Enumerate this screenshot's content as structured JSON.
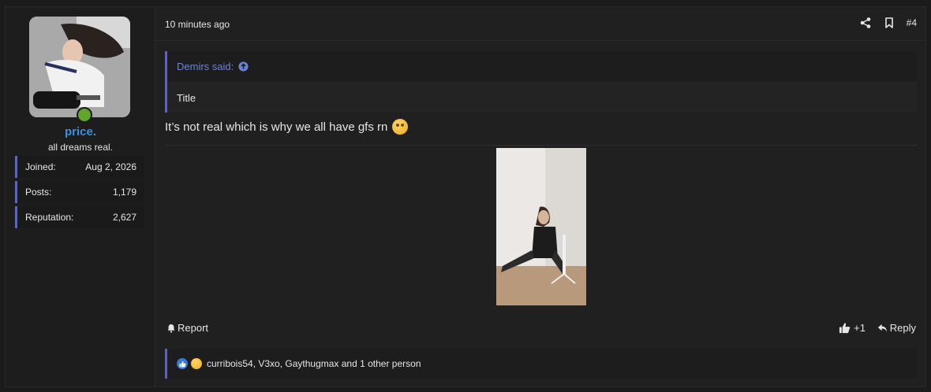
{
  "user": {
    "username": "price.",
    "user_title": "all dreams real.",
    "online": true,
    "stats": [
      {
        "label": "Joined:",
        "value": "Aug 2, 2026"
      },
      {
        "label": "Posts:",
        "value": "1,179"
      },
      {
        "label": "Reputation:",
        "value": "2,627"
      }
    ]
  },
  "post": {
    "time": "10 minutes ago",
    "number": "#4",
    "quote": {
      "author": "Demirs said:",
      "text": "Title"
    },
    "body_text": "It’s not real which is why we all have gfs rn",
    "actions": {
      "report": "Report",
      "like_count": "+1",
      "reply": "Reply"
    },
    "reactions_text": "curribois54, V3xo, Gaythugmax and 1 other person"
  },
  "colors": {
    "accent": "#5b63c4",
    "username": "#3a8fe0",
    "quote_author": "#6a84d8",
    "online": "#62a52d"
  },
  "icons": {
    "header": [
      "share-icon",
      "bookmark-icon"
    ],
    "quote": "arrow-up-circle-icon",
    "footer": [
      "bell-icon",
      "thumbs-up-icon",
      "reply-icon"
    ],
    "reactions": [
      "like-reaction-icon",
      "laugh-reaction-icon"
    ]
  }
}
